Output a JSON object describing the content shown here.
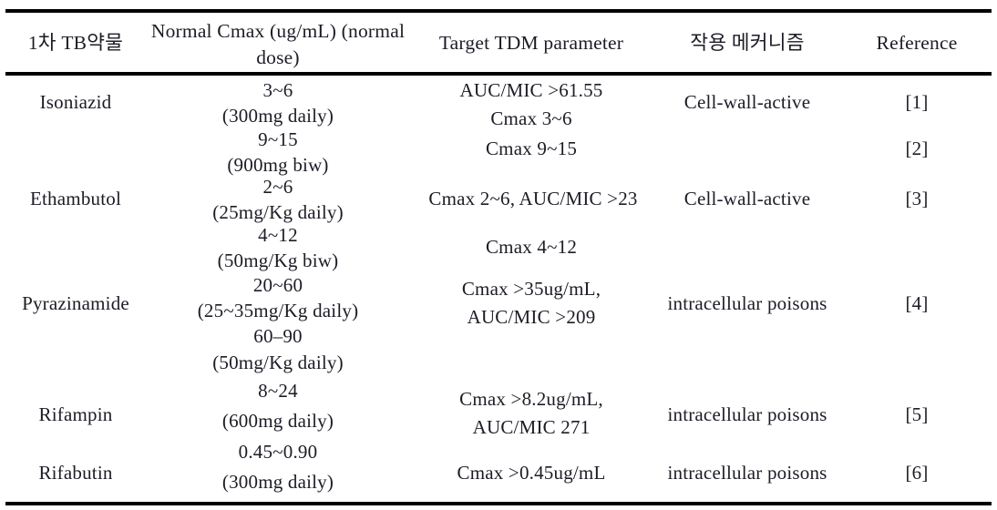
{
  "table": {
    "headers": [
      {
        "id": "drug",
        "label": "1차 TB약물"
      },
      {
        "id": "cmax",
        "label": "Normal Cmax (ug/mL) (normal dose)"
      },
      {
        "id": "tdm",
        "label": "Target TDM parameter"
      },
      {
        "id": "mechanism",
        "label": "작용 메커니즘"
      },
      {
        "id": "reference",
        "label": "Reference"
      }
    ],
    "drugs": [
      {
        "name": "Isoniazid",
        "mechanism": "Cell-wall-active"
      },
      {
        "name": "Ethambutol",
        "mechanism": "Cell-wall-active"
      },
      {
        "name": "Pyrazinamide",
        "mechanism": "intracellular poisons"
      },
      {
        "name": "Rifampin",
        "mechanism": "intracellular poisons"
      },
      {
        "name": "Rifabutin",
        "mechanism": "intracellular poisons"
      }
    ],
    "cmax_values": [
      "3~6",
      "(300mg daily)",
      "9~15",
      "(900mg biw)",
      "2~6",
      "(25mg/Kg daily)",
      "4~12",
      "(50mg/Kg biw)",
      "20~60",
      "(25~35mg/Kg daily)",
      "60–90",
      "(50mg/Kg daily)",
      "8~24",
      "(600mg daily)",
      "0.45~0.90",
      "(300mg daily)"
    ],
    "tdm_values": [
      "AUC/MIC >61.55",
      "Cmax 3~6",
      "Cmax 9~15",
      "Cmax 2~6, AUC/MIC >23",
      "Cmax 4~12",
      "Cmax >35ug/mL,",
      "AUC/MIC >209",
      "Cmax >8.2ug/mL,",
      "AUC/MIC 271",
      "Cmax >0.45ug/mL"
    ],
    "references": [
      "[1]",
      "[2]",
      "[3]",
      "[4]",
      "[5]",
      "[6]"
    ]
  }
}
